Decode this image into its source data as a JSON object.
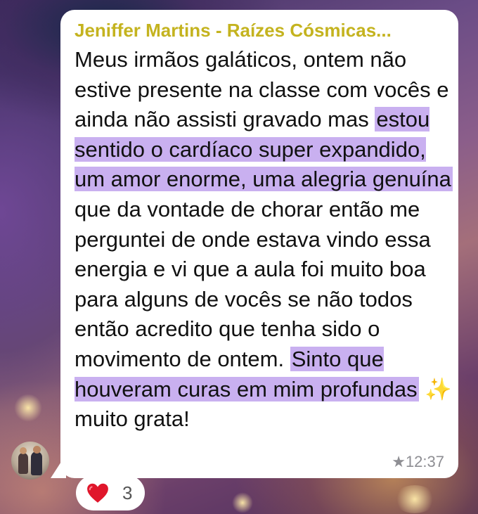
{
  "message": {
    "sender": "Jeniffer Martins - Raízes Cósmicas...",
    "text_intro": "Meus irmãos galáticos, ontem não estive presente na classe com vocês e ainda não assisti gravado mas",
    "highlight_1": "estou sentido o cardíaco super expandido, um amor enorme, uma alegria genuína",
    "text_middle": "que da vontade de chorar então me perguntei de onde estava vindo essa energia e vi que a aula foi muito boa para alguns de vocês se não todos então acredito que tenha sido o movimento de ontem.",
    "highlight_2": "Sinto que houveram curas em mim profundas",
    "emoji": "✨",
    "text_end": "muito grata!",
    "star_icon": "★",
    "time": "12:37"
  },
  "reaction": {
    "emoji": "heart-icon",
    "count": "3"
  },
  "colors": {
    "sender": "#c4b31f",
    "highlight": "#c9b0f0",
    "bubble": "#ffffff",
    "heart": "#e0162b"
  }
}
